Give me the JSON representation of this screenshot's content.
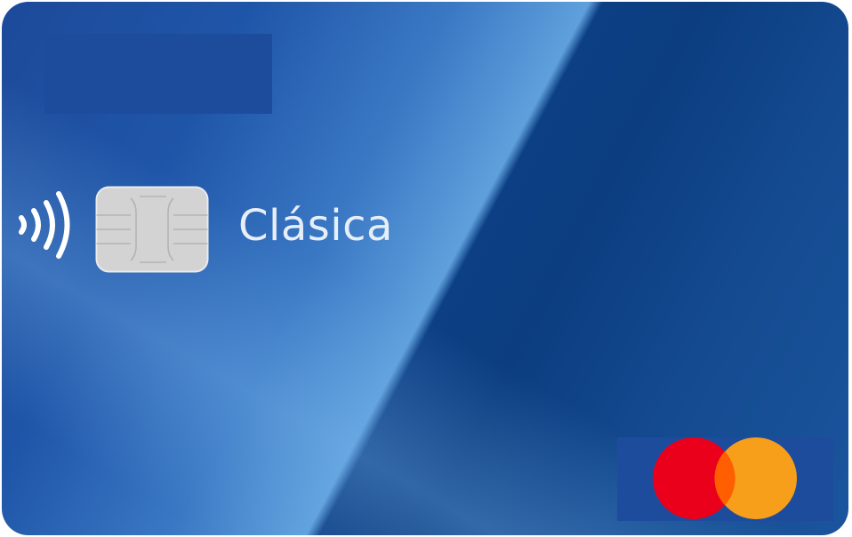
{
  "card": {
    "name": "Clásica",
    "colors": {
      "primary": "#1d4a9a",
      "dark": "#0b3d80",
      "highlight": "#5fa0dc",
      "chip": "#d2d2d2",
      "brand_red": "#eb001b",
      "brand_orange": "#f79e1b",
      "brand_overlap": "#ff5f00"
    },
    "icons": {
      "contactless": "contactless-icon",
      "chip": "emv-chip-icon",
      "network": "mastercard-logo-icon"
    }
  }
}
